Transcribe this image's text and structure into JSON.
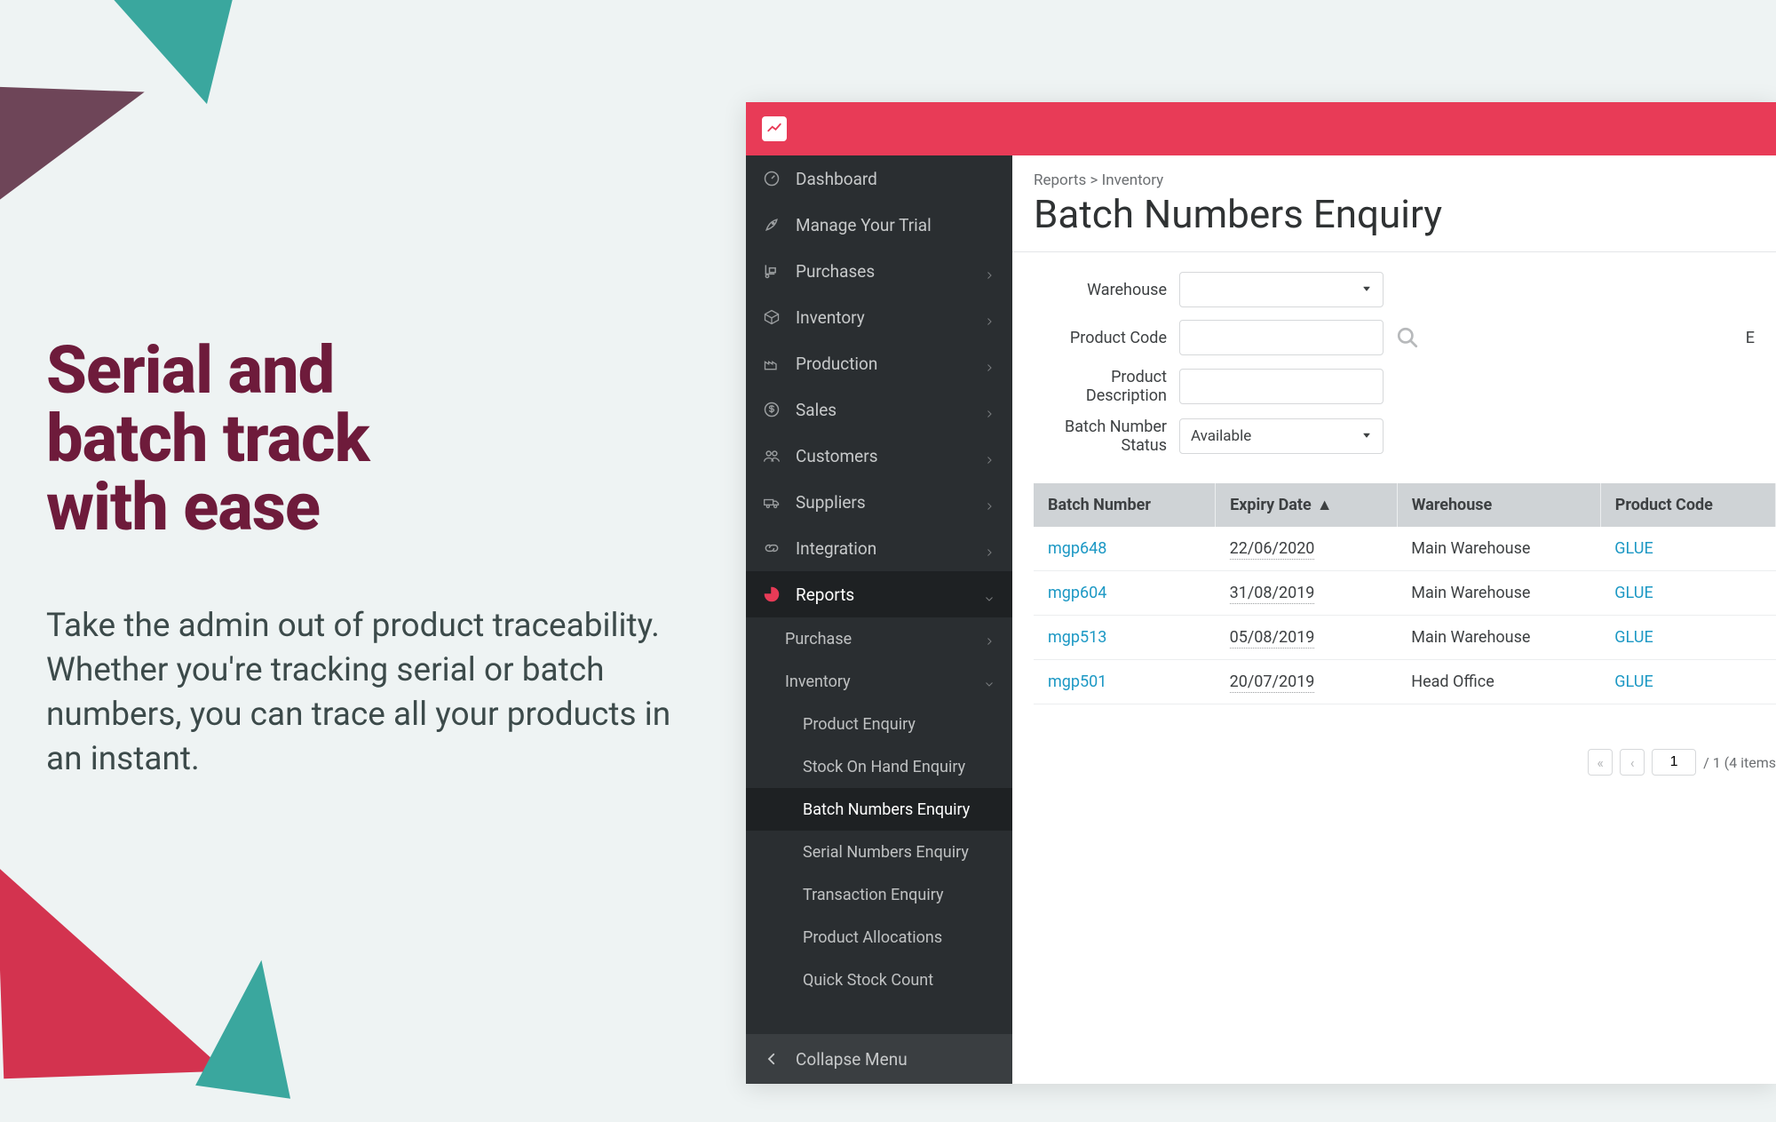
{
  "marketing": {
    "headline_line1": "Serial and",
    "headline_line2": "batch track",
    "headline_line3": "with ease",
    "body": "Take the admin out of product traceability. Whether you're tracking serial or batch numbers, you can trace all your products in an instant."
  },
  "sidebar": {
    "items": [
      {
        "label": "Dashboard",
        "icon": "gauge",
        "expandable": false
      },
      {
        "label": "Manage Your Trial",
        "icon": "rocket",
        "expandable": false
      },
      {
        "label": "Purchases",
        "icon": "hand-truck",
        "expandable": true
      },
      {
        "label": "Inventory",
        "icon": "box",
        "expandable": true
      },
      {
        "label": "Production",
        "icon": "factory",
        "expandable": true
      },
      {
        "label": "Sales",
        "icon": "dollar",
        "expandable": true
      },
      {
        "label": "Customers",
        "icon": "people",
        "expandable": true
      },
      {
        "label": "Suppliers",
        "icon": "truck",
        "expandable": true
      },
      {
        "label": "Integration",
        "icon": "link",
        "expandable": true
      },
      {
        "label": "Reports",
        "icon": "pie",
        "expandable": true,
        "active": true
      }
    ],
    "reports_children": [
      {
        "label": "Purchase",
        "expandable": true
      },
      {
        "label": "Inventory",
        "expandable": true,
        "open": true
      }
    ],
    "inventory_reports": [
      {
        "label": "Product Enquiry"
      },
      {
        "label": "Stock On Hand Enquiry"
      },
      {
        "label": "Batch Numbers Enquiry",
        "active": true
      },
      {
        "label": "Serial Numbers Enquiry"
      },
      {
        "label": "Transaction Enquiry"
      },
      {
        "label": "Product Allocations"
      },
      {
        "label": "Quick Stock Count"
      }
    ],
    "collapse": "Collapse Menu"
  },
  "breadcrumb": "Reports > Inventory",
  "page_title": "Batch Numbers Enquiry",
  "filters": {
    "warehouse_label": "Warehouse",
    "warehouse_value": "",
    "product_code_label": "Product Code",
    "product_code_value": "",
    "product_desc_label": "Product Description",
    "product_desc_value": "",
    "batch_status_label": "Batch Number Status",
    "batch_status_value": "Available",
    "right_label_fragment": "E"
  },
  "table": {
    "headers": [
      "Batch Number",
      "Expiry Date",
      "Warehouse",
      "Product Code"
    ],
    "sorted_col": 1,
    "rows": [
      {
        "batch": "mgp648",
        "expiry": "22/06/2020",
        "warehouse": "Main Warehouse",
        "product": "GLUE"
      },
      {
        "batch": "mgp604",
        "expiry": "31/08/2019",
        "warehouse": "Main Warehouse",
        "product": "GLUE"
      },
      {
        "batch": "mgp513",
        "expiry": "05/08/2019",
        "warehouse": "Main Warehouse",
        "product": "GLUE"
      },
      {
        "batch": "mgp501",
        "expiry": "20/07/2019",
        "warehouse": "Head Office",
        "product": "GLUE"
      }
    ]
  },
  "pager": {
    "page": "1",
    "total_text": "/ 1 (4 items"
  }
}
